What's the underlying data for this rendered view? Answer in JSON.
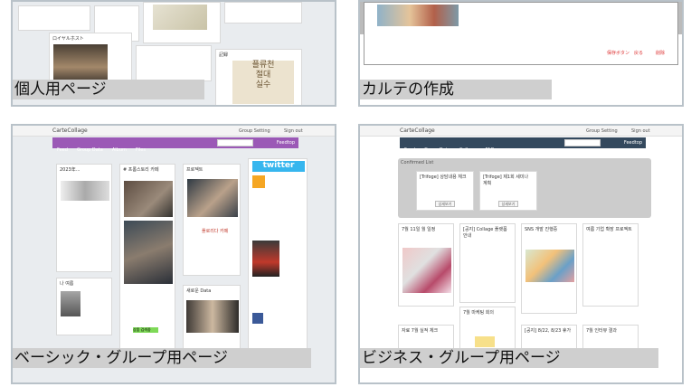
{
  "captions": {
    "personal": "個人用ページ",
    "karte": "カルテの作成",
    "basic": "ベーシック・グループ用ページ",
    "business": "ビジネス・グループ用ページ"
  },
  "app": {
    "logo": "CarteCollage",
    "basic_nav": [
      "Feed",
      "Group Data",
      "Album",
      "Files"
    ],
    "business_nav": [
      "Feed",
      "Group Data",
      "Collage",
      "FAQ"
    ],
    "nav_right": "Feedtop",
    "search_placeholder": "Search",
    "top_links": [
      "Group Setting",
      "Sign out"
    ]
  },
  "panel1": {
    "card_titles": [
      "ロイヤルホスト",
      "記録"
    ],
    "book_text": "플류천\n절대\n실수"
  },
  "panel2": {
    "footer_buttons": [
      "保存ボタン",
      "戻る",
      "削除"
    ]
  },
  "panel3": {
    "cards": [
      "2023年...",
      "# 프롬스토리 카페",
      "프로젝트",
      "나 여름",
      "새로운 Data"
    ],
    "twitter": "twitter",
    "highlight": "상품 검색중",
    "photo_caption": "플로리다 카페"
  },
  "panel4": {
    "confirmed_title": "Confirmed List",
    "confirmed_cards": [
      "[Trifoge] 상담내용 체크",
      "[Trifoge] 제1회 세미나 계획"
    ],
    "confirm_btn": "상세보기",
    "columns": [
      "7월 11일 월 일정",
      "[공지] Collage 플랫폼 안내",
      "SNS 개발 진행중",
      "여름 기업 확장 프로젝트",
      "7월 마케팅 회의",
      "자료 7월 실적 체크",
      "[공지] 8/22, 8/23 휴가",
      "7월 인터뷰 결과"
    ]
  },
  "colors": {
    "basic_nav": "#9b59b6",
    "business_nav": "#34495e",
    "twitter": "#37b6ee",
    "caption_bg": "#cfcfcf"
  }
}
